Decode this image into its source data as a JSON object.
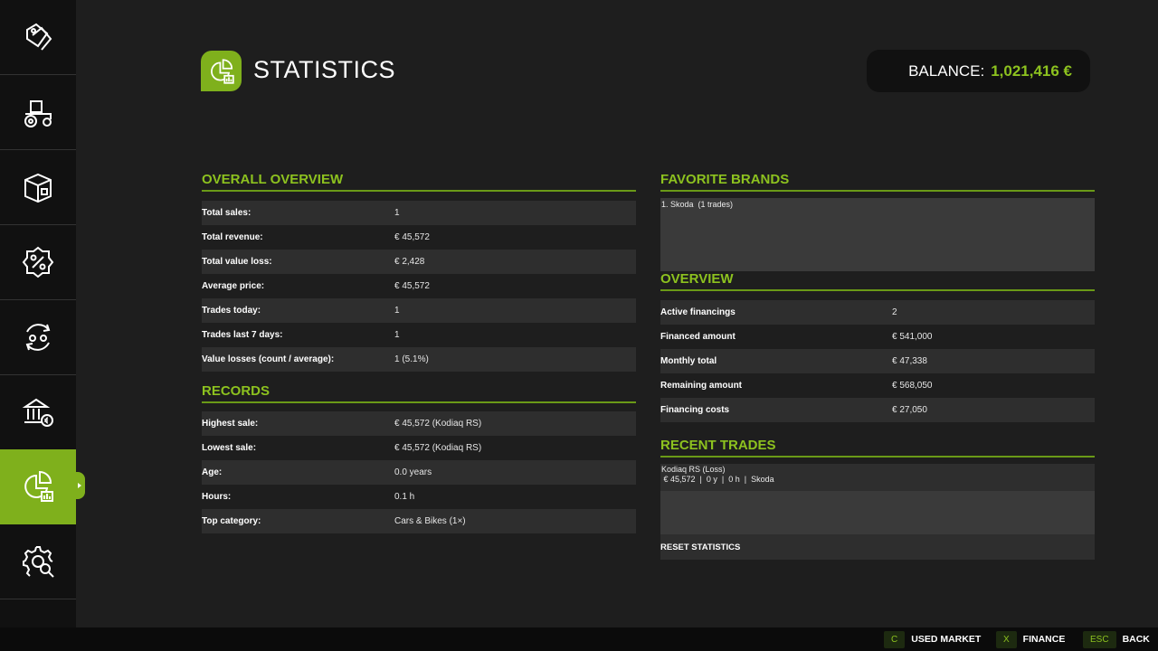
{
  "header": {
    "title": "STATISTICS",
    "balance_label": "BALANCE:",
    "balance_value": "1,021,416 €"
  },
  "sidebar": {
    "items": [
      {
        "icon": "price-tags-icon"
      },
      {
        "icon": "tractor-icon"
      },
      {
        "icon": "box-icon"
      },
      {
        "icon": "percent-badge-icon"
      },
      {
        "icon": "trade-cycle-icon"
      },
      {
        "icon": "bank-icon"
      },
      {
        "icon": "statistics-icon",
        "active": true
      },
      {
        "icon": "gear-search-icon"
      }
    ]
  },
  "overall": {
    "title": "OVERALL OVERVIEW",
    "rows": [
      {
        "label": "Total sales:",
        "value": "1"
      },
      {
        "label": "Total revenue:",
        "value": "€ 45,572"
      },
      {
        "label": "Total value loss:",
        "value": "€ 2,428"
      },
      {
        "label": "Average price:",
        "value": "€ 45,572"
      },
      {
        "label": "Trades today:",
        "value": "1"
      },
      {
        "label": "Trades last 7 days:",
        "value": "1"
      },
      {
        "label": "Value losses (count / average):",
        "value": "1 (5.1%)"
      }
    ]
  },
  "records": {
    "title": "RECORDS",
    "rows": [
      {
        "label": "Highest sale:",
        "value": "€ 45,572 (Kodiaq RS)"
      },
      {
        "label": "Lowest sale:",
        "value": "€ 45,572 (Kodiaq RS)"
      },
      {
        "label": "Age:",
        "value": "0.0 years"
      },
      {
        "label": "Hours:",
        "value": "0.1 h"
      },
      {
        "label": "Top category:",
        "value": "Cars & Bikes (1×)"
      }
    ]
  },
  "favorite_brands": {
    "title": "FAVORITE BRANDS",
    "text": "1. Skoda  (1 trades)"
  },
  "overview": {
    "title": "OVERVIEW",
    "rows": [
      {
        "label": "Active financings",
        "value": "2"
      },
      {
        "label": "Financed amount",
        "value": "€ 541,000"
      },
      {
        "label": "Monthly total",
        "value": "€ 47,338"
      },
      {
        "label": "Remaining amount",
        "value": "€ 568,050"
      },
      {
        "label": "Financing costs",
        "value": "€ 27,050"
      }
    ]
  },
  "recent_trades": {
    "title": "RECENT TRADES",
    "line1": "Kodiaq RS (Loss)",
    "line2": " € 45,572  |  0 y  |  0 h  |  Skoda",
    "reset_label": "RESET STATISTICS"
  },
  "footer": {
    "buttons": [
      {
        "key": "C",
        "label": "USED MARKET"
      },
      {
        "key": "X",
        "label": "FINANCE"
      },
      {
        "key": "ESC",
        "label": "BACK"
      }
    ]
  },
  "colors": {
    "accent": "#7fb01c",
    "accent_text": "#8dc21f",
    "background": "#1e1e1e",
    "sidebar": "#111111"
  }
}
